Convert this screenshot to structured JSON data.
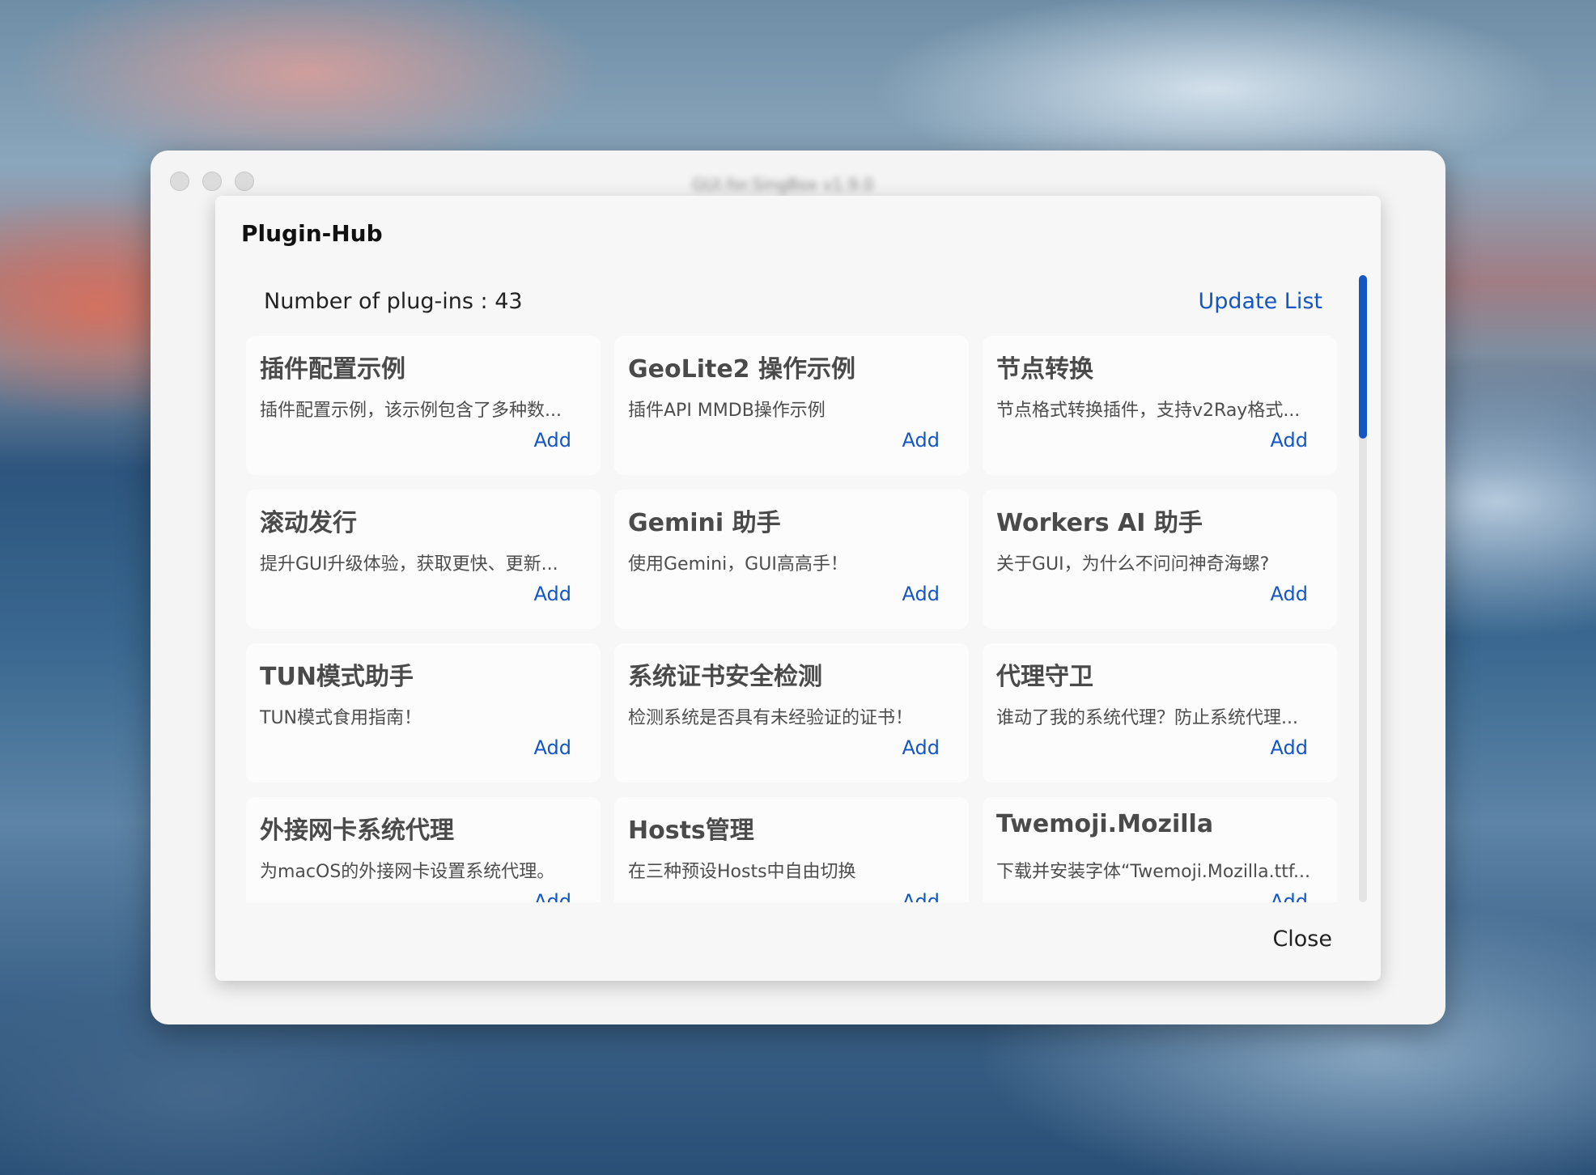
{
  "window": {
    "title": "GUI.for.SingBox v1.9.0"
  },
  "dialog": {
    "title": "Plugin-Hub",
    "count_text": "Number of plug-ins : 43",
    "update_label": "Update List",
    "close_label": "Close"
  },
  "plugins": [
    {
      "title": "插件配置示例",
      "desc": "插件配置示例，该示例包含了多种数...",
      "add": "Add"
    },
    {
      "title": "GeoLite2 操作示例",
      "desc": "插件API MMDB操作示例",
      "add": "Add"
    },
    {
      "title": "节点转换",
      "desc": "节点格式转换插件，支持v2Ray格式...",
      "add": "Add"
    },
    {
      "title": "滚动发行",
      "desc": "提升GUI升级体验，获取更快、更新...",
      "add": "Add"
    },
    {
      "title": "Gemini 助手",
      "desc": "使用Gemini，GUI高高手！",
      "add": "Add"
    },
    {
      "title": "Workers AI 助手",
      "desc": "关于GUI，为什么不问问神奇海螺?",
      "add": "Add"
    },
    {
      "title": "TUN模式助手",
      "desc": "TUN模式食用指南！",
      "add": "Add"
    },
    {
      "title": "系统证书安全检测",
      "desc": "检测系统是否具有未经验证的证书！",
      "add": "Add"
    },
    {
      "title": "代理守卫",
      "desc": "谁动了我的系统代理？防止系统代理...",
      "add": "Add"
    },
    {
      "title": "外接网卡系统代理",
      "desc": "为macOS的外接网卡设置系统代理。",
      "add": "Add"
    },
    {
      "title": "Hosts管理",
      "desc": "在三种预设Hosts中自由切换",
      "add": "Add"
    },
    {
      "title": "Twemoji.Mozilla",
      "desc": "下载并安装字体“Twemoji.Mozilla.ttf...",
      "add": "Add"
    }
  ],
  "scroll": {
    "position_fraction": 0.0,
    "visible_fraction": 0.26
  }
}
